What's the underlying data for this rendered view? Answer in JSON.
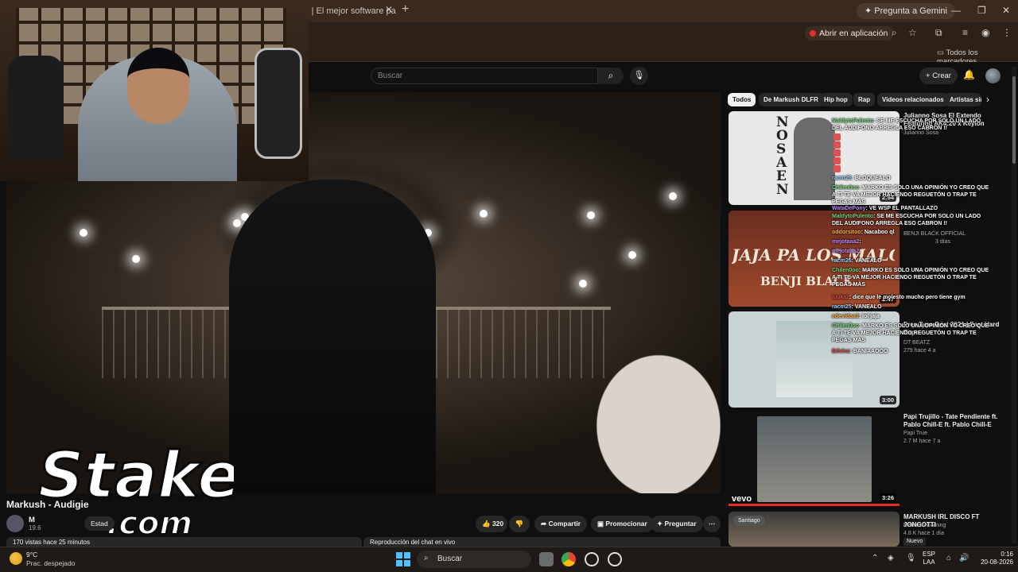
{
  "browser": {
    "tab_title": "ts | El mejor software pa",
    "gemini_label": "Pregunta a Gemini",
    "open_in_app": "Abrir en aplicación",
    "all_bookmarks": "Todos los marcadores"
  },
  "youtube": {
    "search_placeholder": "Buscar",
    "create_label": "Crear",
    "chips": [
      "Todos",
      "De Markush DLFR",
      "Hip hop",
      "Rap",
      "Videos relacionados",
      "Artistas sir"
    ],
    "video": {
      "title": "Markush - Audigie",
      "channel": "M",
      "subscribers": "19.6",
      "state_chip": "Estad",
      "likes": "320",
      "share": "Compartir",
      "promote": "Promocionar",
      "ask": "Preguntar",
      "views_line": "170 vistas  hace 25 minutos",
      "chat_summary": "Reproducción del chat en vivo"
    },
    "overlay_logo": "Stake",
    "overlay_logo_sub": ".com",
    "recommendations": [
      {
        "title": "Julianno Sosa El Extendo Featuring AK4:20 x Keylon",
        "channel": "Julianno Sosa",
        "meta": "",
        "duration": "2:54",
        "thumb_text": "NOSAEN"
      },
      {
        "title": "",
        "channel": "BENJI BLACK OFFICIAL",
        "meta": "3 días",
        "duration": "2:47",
        "thumb_text": "JAJA PA LOS MALOTES",
        "thumb_sub": "BENJI BLACK"
      },
      {
        "title": "Free Type Beat 2021 | Fast Hard Rap",
        "channel": "DT BEATZ",
        "meta": "279  hace 4 a",
        "duration": "3:00"
      },
      {
        "title": "Papi Trujillo - Tate Pendiente ft. Pablo Chill-E ft. Pablo Chill-E",
        "channel": "Papi True",
        "meta": "2.7 M  hace 7 a",
        "duration": "3:26",
        "badge": "vevo"
      },
      {
        "title": "MARKUSH IRL DISCO FT JONGOTTI",
        "channel": "Markush Gaming",
        "meta": "4.8 K  hace 1 día",
        "tag": "Nuevo",
        "location": "Santiago"
      }
    ]
  },
  "chat": [
    {
      "user": "MaldytoPulento",
      "text": "SE ME ESCUCHA POR SOLO UN LADO DEL AUDIFONO ARREGLA ESO CABRON !!",
      "color": "#7ad67a"
    },
    {
      "user": "",
      "text": "",
      "color": "#e05050",
      "emote": true
    },
    {
      "user": "",
      "text": "",
      "color": "#e05050",
      "emote": true
    },
    {
      "user": "",
      "text": "",
      "color": "#e05050",
      "emote": true
    },
    {
      "user": "",
      "text": "",
      "color": "#e05050",
      "emote": true
    },
    {
      "user": "",
      "text": "",
      "color": "#e05050",
      "emote": true
    },
    {
      "user": "racm25",
      "text": "BLOQUEALO",
      "color": "#9bd3ff"
    },
    {
      "user": "Chilen0oo",
      "text": "MARKO ES SOLO UNA OPINIÓN YO CREO QUE A TI TE VA MEJOR HACIENDO REGUETÓN O TRAP TE PEGAS MÁS",
      "color": "#7ad67a"
    },
    {
      "user": "WataDePony",
      "text": "VE WSP EL PANTALLAZO",
      "color": "#c28cff"
    },
    {
      "user": "MaldytoPulento",
      "text": "SE ME ESCUCHA POR SOLO UN LADO DEL AUDIFONO ARREGLA ESO CABRON !!",
      "color": "#7ad67a"
    },
    {
      "user": "oddorsitoo",
      "text": "Nacaboo ql",
      "color": "#ffb347"
    },
    {
      "user": "mejotaaa2",
      "text": "",
      "color": "#c28cff"
    },
    {
      "user": "mejotaaa2",
      "text": "",
      "color": "#c28cff"
    },
    {
      "user": "racm25",
      "text": "VANEALO",
      "color": "#9bd3ff"
    },
    {
      "user": "Chilen0oo",
      "text": "MARKO ES SOLO UNA OPINIÓN YO CREO QUE A TI TE VA MEJOR HACIENDO REGUETÓN O TRAP TE PEGAS MÁS",
      "color": "#7ad67a"
    },
    {
      "user": "luukaz",
      "text": "dice que le molesto mucho pero tiene gym",
      "color": "#e05050"
    },
    {
      "user": "racm25",
      "text": "VANEALO",
      "color": "#9bd3ff"
    },
    {
      "user": "edevidaa3",
      "text": "lol jaja",
      "color": "#ffb347"
    },
    {
      "user": "Chilen0oo",
      "text": "MARKO ES SOLO UNA OPINIÓN YO CREO QUE A TI TE VA MEJOR HACIENDO REGUETÓN O TRAP TE PEGAS MÁS",
      "color": "#7ad67a"
    },
    {
      "user": "Edvinz",
      "text": "BANIAAOOO",
      "color": "#e05050"
    }
  ],
  "taskbar": {
    "temperature": "9°C",
    "condition": "Prac. despejado",
    "search": "Buscar",
    "lang1": "ESP",
    "lang2": "LAA",
    "time": "0:16",
    "date": "20-08-2026"
  },
  "colors": {
    "accent": "#3ea6ff",
    "youtube_red": "#e52d27",
    "chrome_bg": "#3a2a1e"
  }
}
